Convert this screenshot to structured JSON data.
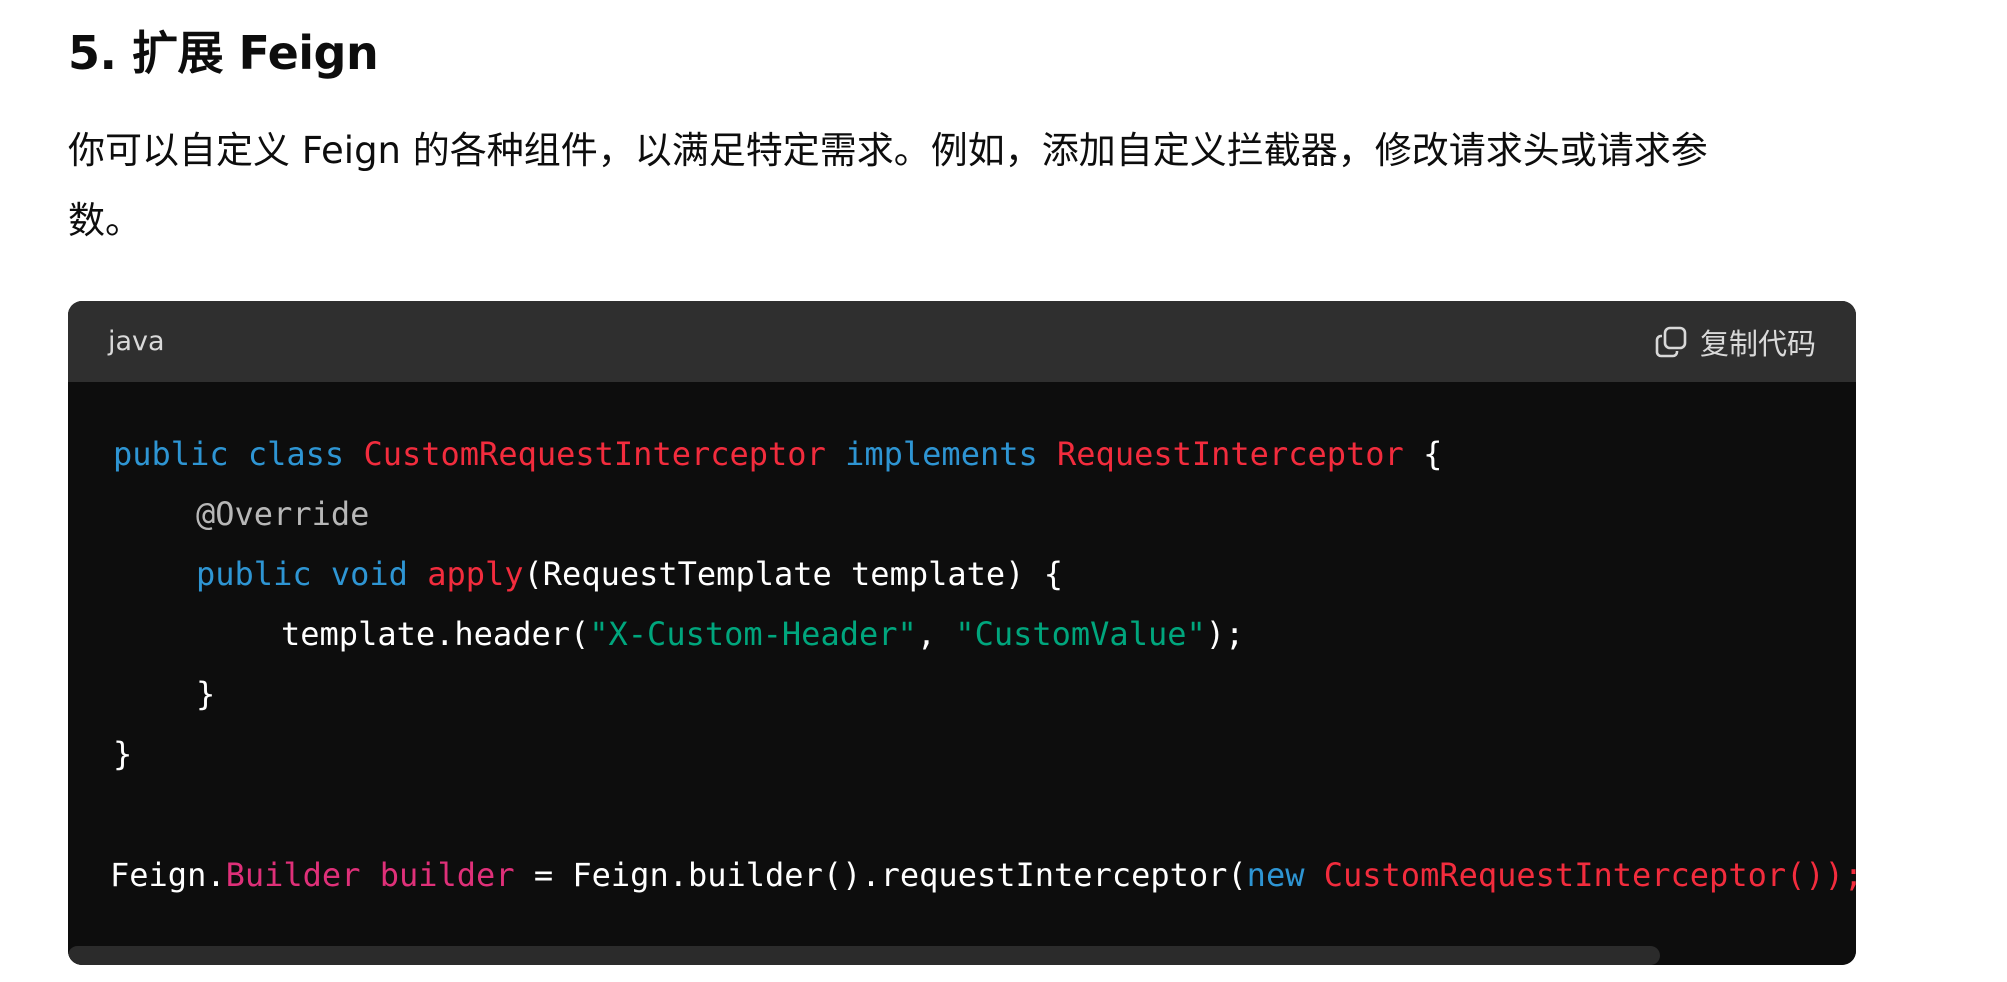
{
  "section": {
    "heading": "5. 扩展 Feign",
    "paragraph_line1": "你可以自定义 Feign 的各种组件，以满足特定需求。例如，添加自定义拦截器，修改请求头或请求参",
    "paragraph_line2": "数。"
  },
  "code_block": {
    "language": "java",
    "copy_label": "复制代码",
    "copy_icon": "copy-icon",
    "colors": {
      "background": "#0d0d0d",
      "header": "#2f2f2f",
      "keyword": "#2e95d3",
      "type": "#f22c3d",
      "annotation": "#b7b7b7",
      "string": "#00a67d",
      "variable": "#df3079",
      "plain": "#ffffff"
    },
    "code": {
      "l1_kw1": "public",
      "l1_kw2": "class",
      "l1_type1": "CustomRequestInterceptor",
      "l1_kw3": "implements",
      "l1_type2": "RequestInterceptor",
      "l1_brace": "{",
      "l2_annotation": "@Override",
      "l3_kw1": "public",
      "l3_kw2": "void",
      "l3_method": "apply",
      "l3_rest": "(RequestTemplate template) {",
      "l4_call": "template.header(",
      "l4_str1": "\"X-Custom-Header\"",
      "l4_sep": ", ",
      "l4_str2": "\"CustomValue\"",
      "l4_end": ");",
      "l5_brace": "}",
      "l6_brace": "}",
      "l8_feign": "Feign.",
      "l8_builder_type": "Builder",
      "l8_builder_var": "builder",
      "l8_mid": " = Feign.builder().requestInterceptor(",
      "l8_new": "new",
      "l8_type": "CustomRequestInterceptor());"
    }
  }
}
